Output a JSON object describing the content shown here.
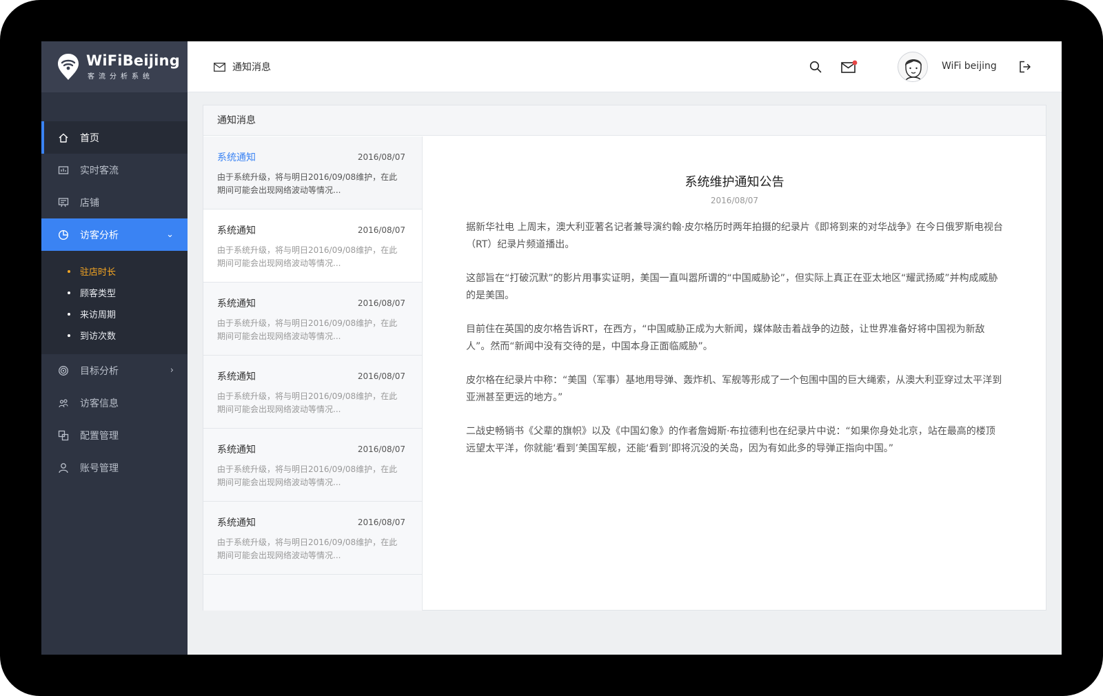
{
  "brand": {
    "title": "WiFiBeijing",
    "subtitle": "客流分析系统"
  },
  "sidebar": {
    "items": [
      {
        "label": "首页",
        "icon": "home-icon"
      },
      {
        "label": "实时客流",
        "icon": "realtime-icon"
      },
      {
        "label": "店铺",
        "icon": "store-icon"
      },
      {
        "label": "访客分析",
        "icon": "pie-chart-icon"
      },
      {
        "label": "目标分析",
        "icon": "target-icon"
      },
      {
        "label": "访客信息",
        "icon": "visitors-icon"
      },
      {
        "label": "配置管理",
        "icon": "config-icon"
      },
      {
        "label": "账号管理",
        "icon": "user-icon"
      }
    ],
    "subitems": [
      "驻店时长",
      "顾客类型",
      "来访周期",
      "到访次数"
    ],
    "active_color": "#3a83f3",
    "current_sub_color": "#f5a623"
  },
  "header": {
    "title": "通知消息",
    "username": "WiFi beijing",
    "notification_dot_color": "#e64545"
  },
  "panel": {
    "title": "通知消息"
  },
  "messages": [
    {
      "title": "系统通知",
      "date": "2016/08/07",
      "body": "由于系统升级，将与明日2016/09/08维护，在此期间可能会出现网络波动等情况..."
    },
    {
      "title": "系统通知",
      "date": "2016/08/07",
      "body": "由于系统升级，将与明日2016/09/08维护，在此期间可能会出现网络波动等情况..."
    },
    {
      "title": "系统通知",
      "date": "2016/08/07",
      "body": "由于系统升级，将与明日2016/09/08维护，在此期间可能会出现网络波动等情况..."
    },
    {
      "title": "系统通知",
      "date": "2016/08/07",
      "body": "由于系统升级，将与明日2016/09/08维护，在此期间可能会出现网络波动等情况..."
    },
    {
      "title": "系统通知",
      "date": "2016/08/07",
      "body": "由于系统升级，将与明日2016/09/08维护，在此期间可能会出现网络波动等情况..."
    },
    {
      "title": "系统通知",
      "date": "2016/08/07",
      "body": "由于系统升级，将与明日2016/09/08维护，在此期间可能会出现网络波动等情况..."
    }
  ],
  "article": {
    "title": "系统维护通知公告",
    "date": "2016/08/07",
    "paragraphs": [
      "据新华社电 上周末，澳大利亚著名记者兼导演约翰·皮尔格历时两年拍摄的纪录片《即将到来的对华战争》在今日俄罗斯电视台（RT）纪录片频道播出。",
      "这部旨在“打破沉默”的影片用事实证明，美国一直叫嚣所谓的“中国威胁论”，但实际上真正在亚太地区“耀武扬威”并构成威胁的是美国。",
      "目前住在英国的皮尔格告诉RT，在西方，“中国威胁正成为大新闻，媒体敲击着战争的边鼓，让世界准备好将中国视为新敌人”。然而“新闻中没有交待的是，中国本身正面临威胁”。",
      "皮尔格在纪录片中称：“美国（军事）基地用导弹、轰炸机、军舰等形成了一个包围中国的巨大绳索，从澳大利亚穿过太平洋到亚洲甚至更远的地方。”",
      "二战史畅销书《父辈的旗帜》以及《中国幻象》的作者詹姆斯·布拉德利也在纪录片中说：“如果你身处北京，站在最高的楼顶远望太平洋，你就能‘看到’美国军舰，还能‘看到’即将沉没的关岛，因为有如此多的导弹正指向中国。”"
    ]
  }
}
